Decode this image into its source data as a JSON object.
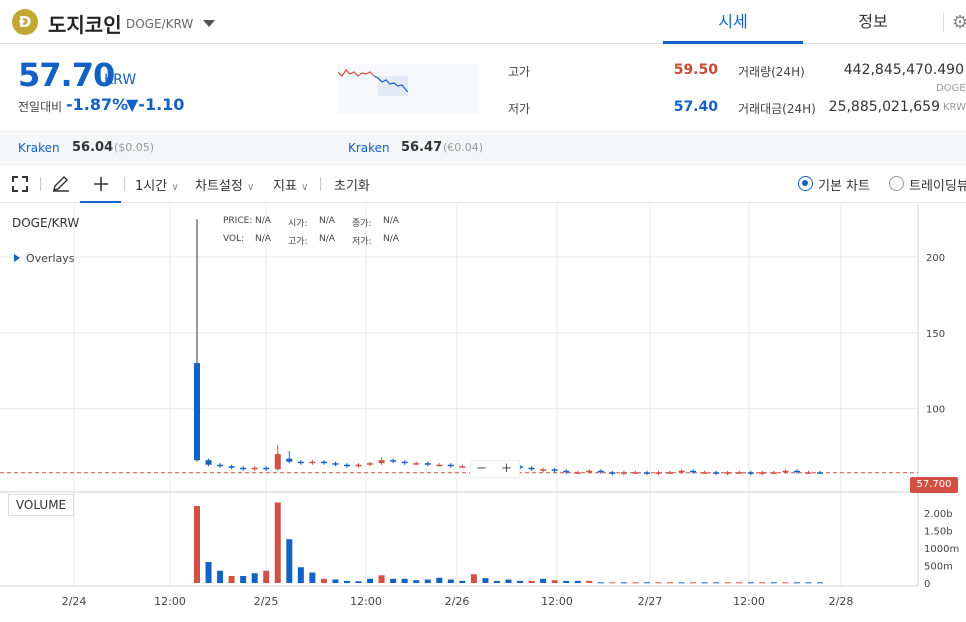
{
  "header": {
    "coin_symbol_glyph": "Ð",
    "coin_name": "도지코인",
    "pair": "DOGE/KRW",
    "tabs": [
      "시세",
      "정보"
    ]
  },
  "ticker": {
    "price": "57.70",
    "unit": "KRW",
    "change_label": "전일대비",
    "change_pct": "-1.87%",
    "change_abs": "▼-1.10",
    "high_label": "고가",
    "high": "59.50",
    "low_label": "저가",
    "low": "57.40",
    "volume_label": "거래량(24H)",
    "volume": "442,845,470.490",
    "volume_unit": "DOGE",
    "amount_label": "거래대금(24H)",
    "amount": "25,885,021,659",
    "amount_unit": "KRW"
  },
  "exchanges": [
    {
      "name": "Kraken",
      "value": "56.04",
      "sub": "($0.05)"
    },
    {
      "name": "Kraken",
      "value": "56.47",
      "sub": "(€0.04)"
    }
  ],
  "toolbar": {
    "interval": "1시간",
    "settings": "차트설정",
    "indicators": "지표",
    "reset": "초기화",
    "basic_chart": "기본 차트",
    "tradingview": "트레이딩뷰"
  },
  "chart": {
    "symbol": "DOGE/KRW",
    "overlays": "Overlays",
    "ohlc_row1": [
      "PRICE:",
      "N/A",
      "시가:",
      "N/A",
      "종가:",
      "N/A"
    ],
    "ohlc_row2": [
      "VOL:",
      "N/A",
      "고가:",
      "N/A",
      "저가:",
      "N/A"
    ],
    "volume_label": "VOLUME",
    "current_price_tag": "57.700",
    "zoom_minus": "−",
    "zoom_plus": "+"
  },
  "colors": {
    "accent": "#1261c4",
    "up": "#d24f45",
    "down": "#1261c4",
    "high_red": "#c84a31"
  },
  "chart_data": {
    "type": "candlestick",
    "price_axis_ticks": [
      "200",
      "150",
      "100"
    ],
    "volume_axis_ticks": [
      "2.00b",
      "1.50b",
      "1000m",
      "500m",
      "0"
    ],
    "x_ticks": [
      "2/24",
      "12:00",
      "2/25",
      "12:00",
      "2/26",
      "12:00",
      "2/27",
      "12:00",
      "2/28"
    ],
    "ylim": [
      45,
      235
    ],
    "candles": [
      {
        "t": 0,
        "o": 130,
        "c": 66,
        "h": 225,
        "l": 65
      },
      {
        "t": 1,
        "o": 66,
        "c": 63,
        "h": 67,
        "l": 62
      },
      {
        "t": 2,
        "o": 63,
        "c": 62,
        "h": 64,
        "l": 61
      },
      {
        "t": 3,
        "o": 62,
        "c": 61,
        "h": 63,
        "l": 60
      },
      {
        "t": 4,
        "o": 61,
        "c": 60,
        "h": 62,
        "l": 59
      },
      {
        "t": 5,
        "o": 60,
        "c": 61,
        "h": 62,
        "l": 59
      },
      {
        "t": 6,
        "o": 61,
        "c": 60,
        "h": 62,
        "l": 59
      },
      {
        "t": 7,
        "o": 60,
        "c": 70,
        "h": 76,
        "l": 59
      },
      {
        "t": 8,
        "o": 67,
        "c": 65,
        "h": 72,
        "l": 64
      },
      {
        "t": 9,
        "o": 65,
        "c": 64,
        "h": 66,
        "l": 63
      },
      {
        "t": 10,
        "o": 64,
        "c": 65,
        "h": 66,
        "l": 63
      },
      {
        "t": 11,
        "o": 65,
        "c": 64,
        "h": 66,
        "l": 63
      },
      {
        "t": 12,
        "o": 64,
        "c": 63,
        "h": 65,
        "l": 62
      },
      {
        "t": 13,
        "o": 63,
        "c": 62,
        "h": 64,
        "l": 61
      },
      {
        "t": 14,
        "o": 62,
        "c": 63,
        "h": 64,
        "l": 61
      },
      {
        "t": 15,
        "o": 63,
        "c": 64,
        "h": 65,
        "l": 62
      },
      {
        "t": 16,
        "o": 64,
        "c": 66,
        "h": 68,
        "l": 63
      },
      {
        "t": 17,
        "o": 66,
        "c": 65,
        "h": 67,
        "l": 64
      },
      {
        "t": 18,
        "o": 65,
        "c": 64,
        "h": 66,
        "l": 63
      },
      {
        "t": 19,
        "o": 64,
        "c": 64,
        "h": 65,
        "l": 63
      },
      {
        "t": 20,
        "o": 64,
        "c": 63,
        "h": 65,
        "l": 62
      },
      {
        "t": 21,
        "o": 63,
        "c": 63,
        "h": 64,
        "l": 62
      },
      {
        "t": 22,
        "o": 63,
        "c": 62,
        "h": 64,
        "l": 61
      },
      {
        "t": 23,
        "o": 62,
        "c": 62,
        "h": 63,
        "l": 61
      },
      {
        "t": 24,
        "o": 62,
        "c": 63,
        "h": 64,
        "l": 61
      },
      {
        "t": 25,
        "o": 63,
        "c": 62,
        "h": 64,
        "l": 61
      },
      {
        "t": 26,
        "o": 62,
        "c": 61,
        "h": 63,
        "l": 60
      },
      {
        "t": 27,
        "o": 61,
        "c": 62,
        "h": 63,
        "l": 60
      },
      {
        "t": 28,
        "o": 62,
        "c": 61,
        "h": 63,
        "l": 60
      },
      {
        "t": 29,
        "o": 61,
        "c": 60,
        "h": 62,
        "l": 59
      },
      {
        "t": 30,
        "o": 60,
        "c": 60,
        "h": 61,
        "l": 58
      },
      {
        "t": 31,
        "o": 60,
        "c": 59,
        "h": 61,
        "l": 58
      },
      {
        "t": 32,
        "o": 59,
        "c": 58,
        "h": 60,
        "l": 57
      },
      {
        "t": 33,
        "o": 58,
        "c": 58,
        "h": 59,
        "l": 57
      },
      {
        "t": 34,
        "o": 58,
        "c": 59,
        "h": 60,
        "l": 57
      },
      {
        "t": 35,
        "o": 59,
        "c": 58,
        "h": 60,
        "l": 57
      },
      {
        "t": 36,
        "o": 58,
        "c": 57,
        "h": 59,
        "l": 56
      },
      {
        "t": 37,
        "o": 57,
        "c": 58,
        "h": 59,
        "l": 56
      },
      {
        "t": 38,
        "o": 58,
        "c": 58,
        "h": 59,
        "l": 57
      },
      {
        "t": 39,
        "o": 58,
        "c": 57,
        "h": 59,
        "l": 56
      },
      {
        "t": 40,
        "o": 57,
        "c": 58,
        "h": 59,
        "l": 56
      },
      {
        "t": 41,
        "o": 58,
        "c": 58,
        "h": 59,
        "l": 57
      },
      {
        "t": 42,
        "o": 58,
        "c": 59,
        "h": 60,
        "l": 57
      },
      {
        "t": 43,
        "o": 59,
        "c": 58,
        "h": 60,
        "l": 57
      },
      {
        "t": 44,
        "o": 58,
        "c": 58,
        "h": 59,
        "l": 57
      },
      {
        "t": 45,
        "o": 58,
        "c": 57,
        "h": 59,
        "l": 56
      },
      {
        "t": 46,
        "o": 57,
        "c": 58,
        "h": 59,
        "l": 56
      },
      {
        "t": 47,
        "o": 58,
        "c": 58,
        "h": 59,
        "l": 57
      },
      {
        "t": 48,
        "o": 58,
        "c": 57,
        "h": 59,
        "l": 56
      },
      {
        "t": 49,
        "o": 57,
        "c": 58,
        "h": 59,
        "l": 56
      },
      {
        "t": 50,
        "o": 58,
        "c": 58,
        "h": 59,
        "l": 57
      },
      {
        "t": 51,
        "o": 58,
        "c": 59,
        "h": 60,
        "l": 57
      },
      {
        "t": 52,
        "o": 59,
        "c": 58,
        "h": 60,
        "l": 57
      },
      {
        "t": 53,
        "o": 58,
        "c": 58,
        "h": 59,
        "l": 57
      },
      {
        "t": 54,
        "o": 58,
        "c": 57.7,
        "h": 59,
        "l": 57
      }
    ],
    "volumes": [
      {
        "t": 0,
        "v": 2.2,
        "up": true
      },
      {
        "t": 1,
        "v": 0.6,
        "up": false
      },
      {
        "t": 2,
        "v": 0.35,
        "up": false
      },
      {
        "t": 3,
        "v": 0.2,
        "up": true
      },
      {
        "t": 4,
        "v": 0.2,
        "up": false
      },
      {
        "t": 5,
        "v": 0.28,
        "up": false
      },
      {
        "t": 6,
        "v": 0.35,
        "up": true
      },
      {
        "t": 7,
        "v": 2.3,
        "up": true
      },
      {
        "t": 8,
        "v": 1.25,
        "up": false
      },
      {
        "t": 9,
        "v": 0.45,
        "up": false
      },
      {
        "t": 10,
        "v": 0.3,
        "up": false
      },
      {
        "t": 11,
        "v": 0.12,
        "up": true
      },
      {
        "t": 12,
        "v": 0.1,
        "up": false
      },
      {
        "t": 13,
        "v": 0.06,
        "up": false
      },
      {
        "t": 14,
        "v": 0.05,
        "up": false
      },
      {
        "t": 15,
        "v": 0.12,
        "up": false
      },
      {
        "t": 16,
        "v": 0.22,
        "up": true
      },
      {
        "t": 17,
        "v": 0.12,
        "up": false
      },
      {
        "t": 18,
        "v": 0.12,
        "up": false
      },
      {
        "t": 19,
        "v": 0.08,
        "up": false
      },
      {
        "t": 20,
        "v": 0.1,
        "up": false
      },
      {
        "t": 21,
        "v": 0.15,
        "up": false
      },
      {
        "t": 22,
        "v": 0.1,
        "up": false
      },
      {
        "t": 23,
        "v": 0.06,
        "up": false
      },
      {
        "t": 24,
        "v": 0.25,
        "up": true
      },
      {
        "t": 25,
        "v": 0.14,
        "up": false
      },
      {
        "t": 26,
        "v": 0.06,
        "up": false
      },
      {
        "t": 27,
        "v": 0.1,
        "up": false
      },
      {
        "t": 28,
        "v": 0.06,
        "up": false
      },
      {
        "t": 29,
        "v": 0.06,
        "up": true
      },
      {
        "t": 30,
        "v": 0.12,
        "up": false
      },
      {
        "t": 31,
        "v": 0.08,
        "up": true
      },
      {
        "t": 32,
        "v": 0.06,
        "up": false
      },
      {
        "t": 33,
        "v": 0.06,
        "up": false
      },
      {
        "t": 34,
        "v": 0.06,
        "up": true
      },
      {
        "t": 35,
        "v": 0.02,
        "up": false
      },
      {
        "t": 36,
        "v": 0.02,
        "up": true
      },
      {
        "t": 37,
        "v": 0.02,
        "up": false
      },
      {
        "t": 38,
        "v": 0.02,
        "up": true
      },
      {
        "t": 39,
        "v": 0.02,
        "up": false
      },
      {
        "t": 40,
        "v": 0.02,
        "up": true
      },
      {
        "t": 41,
        "v": 0.02,
        "up": true
      },
      {
        "t": 42,
        "v": 0.02,
        "up": false
      },
      {
        "t": 43,
        "v": 0.02,
        "up": true
      },
      {
        "t": 44,
        "v": 0.02,
        "up": false
      },
      {
        "t": 45,
        "v": 0.02,
        "up": false
      },
      {
        "t": 46,
        "v": 0.02,
        "up": true
      },
      {
        "t": 47,
        "v": 0.02,
        "up": true
      },
      {
        "t": 48,
        "v": 0.02,
        "up": false
      },
      {
        "t": 49,
        "v": 0.02,
        "up": true
      },
      {
        "t": 50,
        "v": 0.02,
        "up": false
      },
      {
        "t": 51,
        "v": 0.02,
        "up": true
      },
      {
        "t": 52,
        "v": 0.02,
        "up": false
      },
      {
        "t": 53,
        "v": 0.02,
        "up": false
      },
      {
        "t": 54,
        "v": 0.02,
        "up": false
      }
    ],
    "volume_max": 2.4
  }
}
